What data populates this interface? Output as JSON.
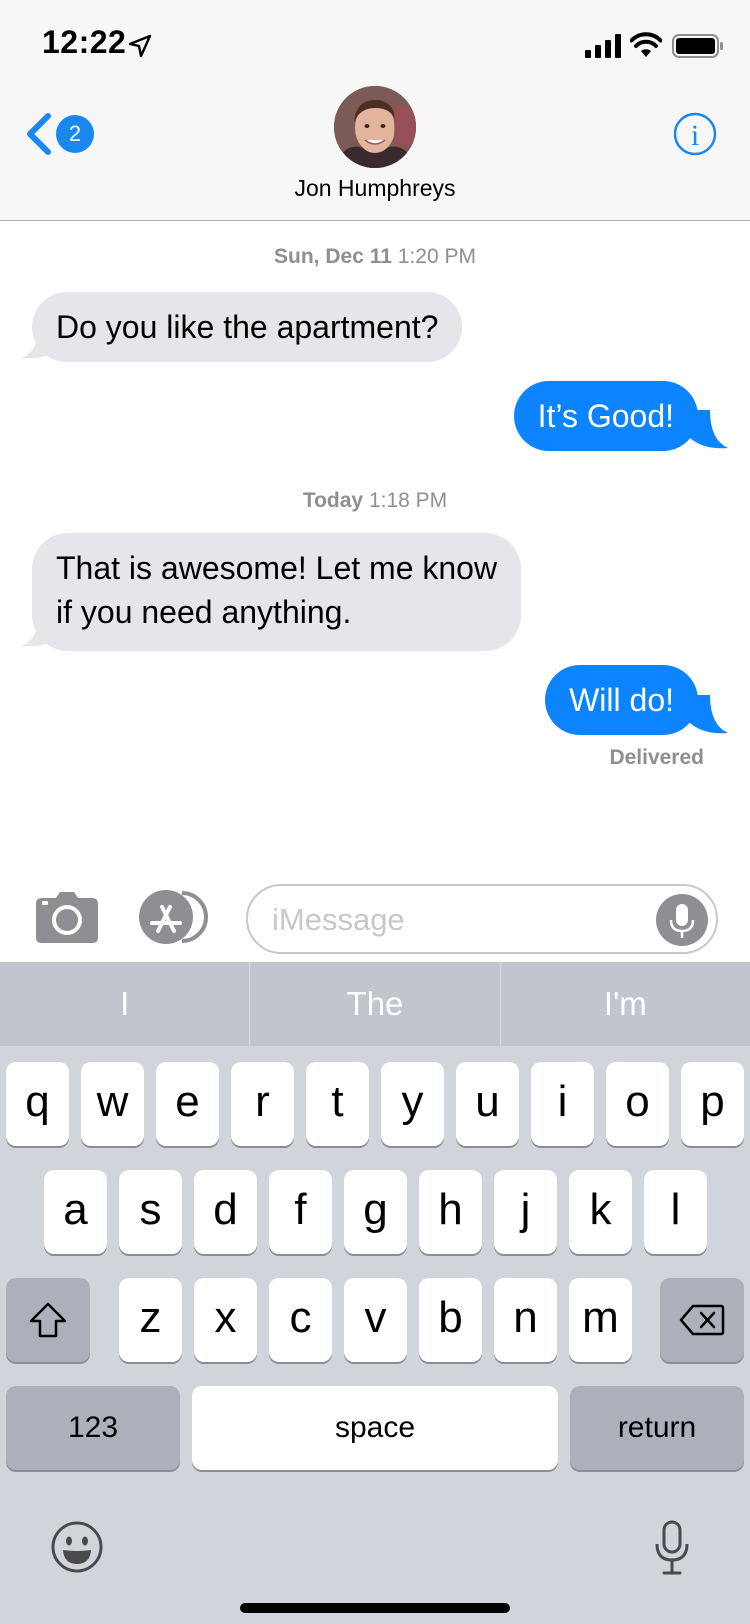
{
  "status_bar": {
    "time": "12:22"
  },
  "header": {
    "back_badge": "2",
    "contact_name": "Jon Humphreys"
  },
  "messages": [
    {
      "day": "Sun, Dec 11",
      "time": "1:20 PM"
    },
    {
      "text": "Do you like the apartment?"
    },
    {
      "text": "It’s Good!"
    },
    {
      "day": "Today",
      "time": "1:18 PM"
    },
    {
      "line1": "That is awesome! Let me know",
      "line2": "if you need anything."
    },
    {
      "text": "Will do!"
    },
    {
      "status": "Delivered"
    }
  ],
  "input": {
    "placeholder": "iMessage",
    "value": ""
  },
  "keyboard": {
    "suggestions": [
      "I",
      "The",
      "I'm"
    ],
    "row1": [
      "q",
      "w",
      "e",
      "r",
      "t",
      "y",
      "u",
      "i",
      "o",
      "p"
    ],
    "row2": [
      "a",
      "s",
      "d",
      "f",
      "g",
      "h",
      "j",
      "k",
      "l"
    ],
    "row3": [
      "z",
      "x",
      "c",
      "v",
      "b",
      "n",
      "m"
    ],
    "numbers_label": "123",
    "space_label": "space",
    "return_label": "return"
  },
  "colors": {
    "accent": "#0d84ff",
    "incoming_bubble": "#e5e5ea",
    "header_bg": "#f7f7f7",
    "keyboard_bg": "#d1d4db"
  }
}
